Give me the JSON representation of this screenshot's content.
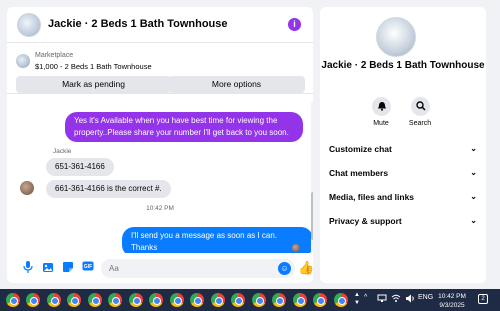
{
  "chat": {
    "title": "Jackie · 2 Beds 1 Bath Townhouse",
    "info_icon": "i",
    "marketplace": {
      "label": "Marketplace",
      "title": "$1,000 - 2 Beds 1 Bath Townhouse",
      "pending_button": "Mark as pending",
      "more_button": "More options"
    },
    "messages": {
      "m1": "Yes it's Available when you have best time for viewing the property..Please share your number I'll get back to you soon.",
      "sender": "Jackie",
      "m2": "651-361-4166",
      "m3": "661-361-4166 is the correct #.",
      "time": "10:42 PM",
      "m4": "I'll send you a message as soon as I can. Thanks"
    },
    "composer": {
      "placeholder": "Aa"
    },
    "colors": {
      "accent": "#9333ea",
      "messenger_blue": "#0a7cff"
    }
  },
  "side": {
    "name": "Jackie · 2 Beds 1 Bath Townhouse",
    "mute_label": "Mute",
    "search_label": "Search",
    "sections": [
      "Customize chat",
      "Chat members",
      "Media, files and links",
      "Privacy & support"
    ]
  },
  "taskbar": {
    "lang": "ENG",
    "time": "10:42 PM",
    "date": "9/3/2025",
    "notifications": "2"
  }
}
